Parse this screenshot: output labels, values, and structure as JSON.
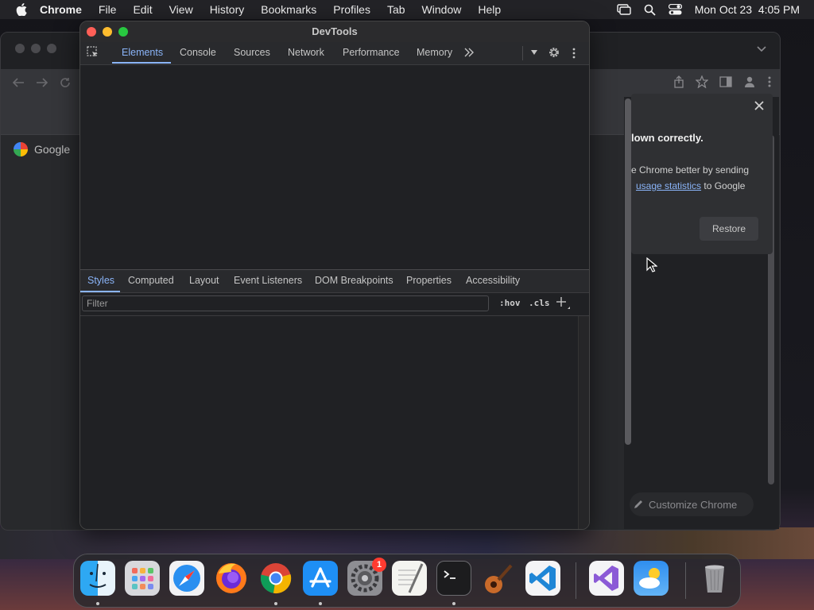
{
  "menubar": {
    "app_name": "Chrome",
    "items": [
      "File",
      "Edit",
      "View",
      "History",
      "Bookmarks",
      "Profiles",
      "Tab",
      "Window",
      "Help"
    ],
    "clock": "Mon Oct 23  4:05 PM"
  },
  "chrome": {
    "bookmark_google": "Google",
    "infobar": {
      "line1": "lown correctly.",
      "line2": "e Chrome better by sending",
      "link": "usage statistics",
      "line3_suffix": " to Google",
      "restore_label": "Restore"
    },
    "customize_label": "Customize Chrome"
  },
  "devtools": {
    "title": "DevTools",
    "tabs": [
      "Elements",
      "Console",
      "Sources",
      "Network",
      "Performance",
      "Memory"
    ],
    "active_tab": "Elements",
    "subtabs": [
      "Styles",
      "Computed",
      "Layout",
      "Event Listeners",
      "DOM Breakpoints",
      "Properties",
      "Accessibility"
    ],
    "active_subtab": "Styles",
    "filter_placeholder": "Filter",
    "hov_label": ":hov",
    "cls_label": ".cls"
  },
  "dock": {
    "apps": [
      "Finder",
      "Launchpad",
      "Safari",
      "Firefox",
      "Chrome",
      "App Store",
      "System Settings",
      "TextEdit",
      "Terminal",
      "Instruments",
      "Visual Studio Code",
      "Visual Studio",
      "Weather",
      "Trash"
    ],
    "settings_badge": "1"
  },
  "colors": {
    "accent": "#8ab4f8",
    "close": "#ff5f57",
    "minimize": "#febc2e",
    "zoom": "#28c840"
  }
}
